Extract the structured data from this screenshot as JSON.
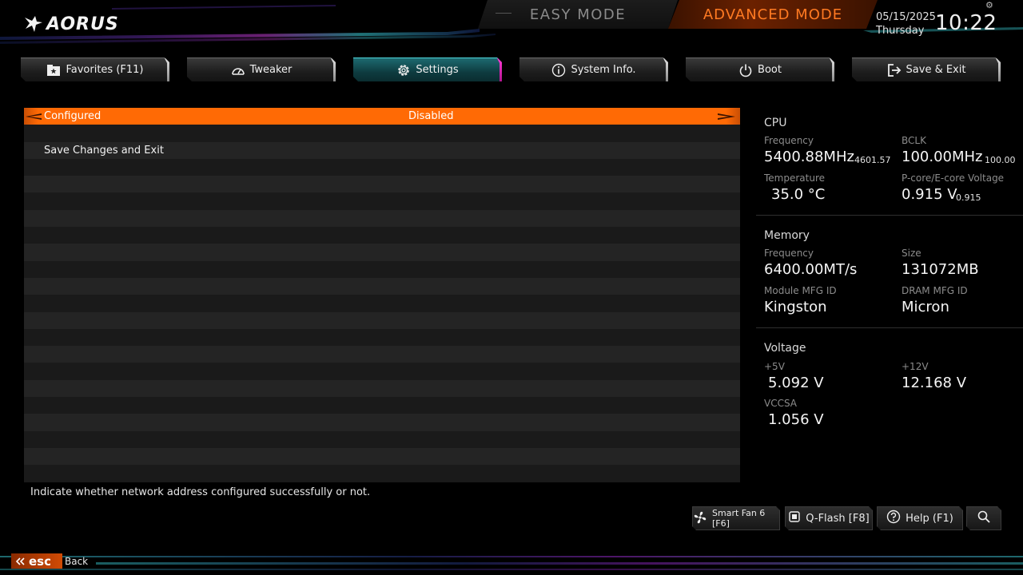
{
  "brand": {
    "logo_text": "AORUS"
  },
  "header": {
    "easy_mode": "EASY MODE",
    "advanced_mode": "ADVANCED MODE",
    "date": "05/15/2025",
    "weekday": "Thursday",
    "time": "10:22"
  },
  "tabs": [
    {
      "label": "Favorites (F11)",
      "icon": "star-folder-icon"
    },
    {
      "label": "Tweaker",
      "icon": "speedometer-icon"
    },
    {
      "label": "Settings",
      "icon": "gear-icon",
      "active": true
    },
    {
      "label": "System Info.",
      "icon": "info-icon"
    },
    {
      "label": "Boot",
      "icon": "power-icon"
    },
    {
      "label": "Save & Exit",
      "icon": "exit-icon"
    }
  ],
  "settings": {
    "items": [
      {
        "label": "Configured",
        "value": "Disabled",
        "selected": true
      },
      {
        "label": "Save Changes and Exit",
        "value": ""
      }
    ],
    "help": "Indicate whether network address configured successfully or not."
  },
  "info": {
    "cpu": {
      "title": "CPU",
      "frequency_label": "Frequency",
      "frequency": "5400.88MHz",
      "frequency_sub": "4601.57",
      "bclk_label": "BCLK",
      "bclk": "100.00MHz",
      "bclk_sub": "100.00",
      "temperature_label": "Temperature",
      "temperature": "35.0 °C",
      "voltage_label": "P-core/E-core Voltage",
      "voltage": "0.915 V",
      "voltage_sub": "0.915"
    },
    "memory": {
      "title": "Memory",
      "frequency_label": "Frequency",
      "frequency": "6400.00MT/s",
      "size_label": "Size",
      "size": "131072MB",
      "module_label": "Module MFG ID",
      "module": "Kingston",
      "dram_label": "DRAM MFG ID",
      "dram": "Micron"
    },
    "voltage": {
      "title": "Voltage",
      "v5_label": "+5V",
      "v5": "5.092 V",
      "v12_label": "+12V",
      "v12": "12.168 V",
      "vccsa_label": "VCCSA",
      "vccsa": "1.056 V"
    }
  },
  "bottom_buttons": {
    "smart_fan": "Smart Fan 6 [F6]",
    "qflash": "Q-Flash [F8]",
    "help": "Help (F1)"
  },
  "footer": {
    "esc": "esc",
    "back": "Back"
  },
  "colors": {
    "accent_orange": "#ff6a05",
    "accent_teal": "#1d6a70",
    "accent_magenta": "#ff3ad6"
  }
}
